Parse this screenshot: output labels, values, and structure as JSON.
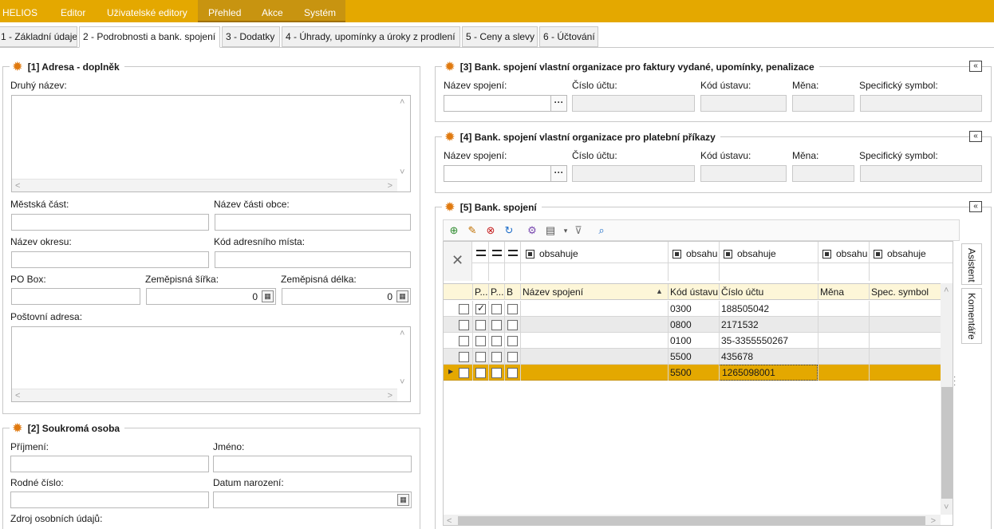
{
  "menubar": {
    "items": [
      "HELIOS",
      "Editor",
      "Uživatelské editory",
      "Přehled",
      "Akce",
      "Systém"
    ],
    "active_group": [
      "Přehled",
      "Akce",
      "Systém"
    ],
    "color": "#e4a800"
  },
  "tabs": [
    {
      "label": "1 - Základní údaje",
      "active": false
    },
    {
      "label": "2 - Podrobnosti a bank. spojení",
      "active": true
    },
    {
      "label": "3 - Dodatky",
      "active": false
    },
    {
      "label": "4 - Úhrady, upomínky a úroky z prodlení",
      "active": false
    },
    {
      "label": "5 - Ceny a slevy",
      "active": false
    },
    {
      "label": "6 - Účtování",
      "active": false
    }
  ],
  "group1": {
    "title": "[1] Adresa - doplněk",
    "druhy_nazev_label": "Druhý název:",
    "mestska_cast_label": "Městská část:",
    "nazev_casti_obce_label": "Název části obce:",
    "nazev_okresu_label": "Název okresu:",
    "kod_adresniho_mista_label": "Kód adresního místa:",
    "po_box_label": "PO Box:",
    "zemepisna_sirka_label": "Zeměpisná šířka:",
    "zemepisna_delka_label": "Zeměpisná délka:",
    "zemepisna_sirka_value": "0",
    "zemepisna_delka_value": "0",
    "postovni_adresa_label": "Poštovní adresa:"
  },
  "group2": {
    "title": "[2] Soukromá osoba",
    "prijmeni_label": "Příjmení:",
    "jmeno_label": "Jméno:",
    "rodne_cislo_label": "Rodné číslo:",
    "datum_narozeni_label": "Datum narození:",
    "zdroj_label": "Zdroj osobních údajů:"
  },
  "group3": {
    "title": "[3] Bank. spojení vlastní organizace pro faktury vydané, upomínky, penalizace",
    "nazev_spojeni_label": "Název spojení:",
    "cislo_uctu_label": "Číslo účtu:",
    "kod_ustavu_label": "Kód ústavu:",
    "mena_label": "Měna:",
    "specificky_symbol_label": "Specifický symbol:",
    "collapse": "«"
  },
  "group4": {
    "title": "[4] Bank. spojení vlastní organizace pro platební příkazy",
    "nazev_spojeni_label": "Název spojení:",
    "cislo_uctu_label": "Číslo účtu:",
    "kod_ustavu_label": "Kód ústavu:",
    "mena_label": "Měna:",
    "specificky_symbol_label": "Specifický symbol:",
    "collapse": "«"
  },
  "group5": {
    "title": "[5] Bank. spojení",
    "collapse": "«",
    "filter_row": {
      "nazev": "obsahuje",
      "kod_ustavu": "obsahu",
      "cislo_uctu": "obsahuje",
      "mena": "obsahu",
      "spec_symbol": "obsahuje"
    },
    "columns": {
      "p1": "P...",
      "p2": "P...",
      "b": "B",
      "nazev_spojeni": "Název spojení",
      "kod_ustavu": "Kód ústavu",
      "cislo_uctu": "Číslo účtu",
      "mena": "Měna",
      "spec_symbol": "Spec. symbol"
    },
    "rows": [
      {
        "p1": true,
        "p2": false,
        "b": false,
        "nazev": "",
        "kod": "0300",
        "cislo": "188505042",
        "mena": "",
        "spec": "",
        "selected": false
      },
      {
        "p1": false,
        "p2": false,
        "b": false,
        "nazev": "",
        "kod": "0800",
        "cislo": "2171532",
        "mena": "",
        "spec": "",
        "selected": false
      },
      {
        "p1": false,
        "p2": false,
        "b": false,
        "nazev": "",
        "kod": "0100",
        "cislo": "35-3355550267",
        "mena": "",
        "spec": "",
        "selected": false
      },
      {
        "p1": false,
        "p2": false,
        "b": false,
        "nazev": "",
        "kod": "5500",
        "cislo": "435678",
        "mena": "",
        "spec": "",
        "selected": false
      },
      {
        "p1": false,
        "p2": false,
        "b": false,
        "nazev": "",
        "kod": "5500",
        "cislo": "1265098001",
        "mena": "",
        "spec": "",
        "selected": true
      }
    ],
    "side_tabs": [
      "Asistent",
      "Komentáře"
    ],
    "selected_row_color": "#e4a800"
  }
}
